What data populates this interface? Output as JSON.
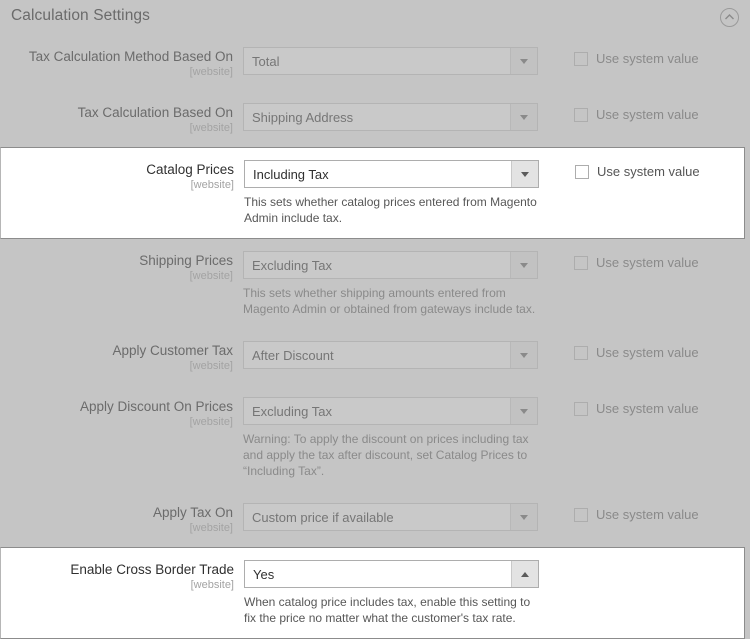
{
  "header": {
    "title": "Calculation Settings",
    "collapse_icon": "chevron-up-circle-icon"
  },
  "common": {
    "scope_label": "[website]",
    "use_system_value_label": "Use system value"
  },
  "colors": {
    "page_background": "#c5c5c5",
    "highlight_background": "#ffffff",
    "label_text": "#6b6b6b",
    "scope_text": "#a3a3a3",
    "focus_border": "#8fc3e8"
  },
  "rows": [
    {
      "label": "Tax Calculation Method Based On",
      "scope": "[website]",
      "value": "Total",
      "help": "",
      "use_system_value": "Use system value",
      "highlighted": false,
      "arrow": "down"
    },
    {
      "label": "Tax Calculation Based On",
      "scope": "[website]",
      "value": "Shipping Address",
      "help": "",
      "use_system_value": "Use system value",
      "highlighted": false,
      "arrow": "down"
    },
    {
      "label": "Catalog Prices",
      "scope": "[website]",
      "value": "Including Tax",
      "help": "This sets whether catalog prices entered from Magento Admin include tax.",
      "use_system_value": "Use system value",
      "highlighted": true,
      "arrow": "down"
    },
    {
      "label": "Shipping Prices",
      "scope": "[website]",
      "value": "Excluding Tax",
      "help": "This sets whether shipping amounts entered from Magento Admin or obtained from gateways include tax.",
      "use_system_value": "Use system value",
      "highlighted": false,
      "arrow": "down"
    },
    {
      "label": "Apply Customer Tax",
      "scope": "[website]",
      "value": "After Discount",
      "help": "",
      "use_system_value": "Use system value",
      "highlighted": false,
      "arrow": "down"
    },
    {
      "label": "Apply Discount On Prices",
      "scope": "[website]",
      "value": "Excluding Tax",
      "help": "Warning: To apply the discount on prices including tax and apply the tax after discount, set Catalog Prices to “Including Tax”.",
      "use_system_value": "Use system value",
      "highlighted": false,
      "arrow": "down"
    },
    {
      "label": "Apply Tax On",
      "scope": "[website]",
      "value": "Custom price if available",
      "help": "",
      "use_system_value": "Use system value",
      "highlighted": false,
      "arrow": "down"
    },
    {
      "label": "Enable Cross Border Trade",
      "scope": "[website]",
      "value": "Yes",
      "help": "When catalog price includes tax, enable this setting to fix the price no matter what the customer's tax rate.",
      "use_system_value": "",
      "highlighted": true,
      "focused": true,
      "arrow": "up"
    }
  ]
}
